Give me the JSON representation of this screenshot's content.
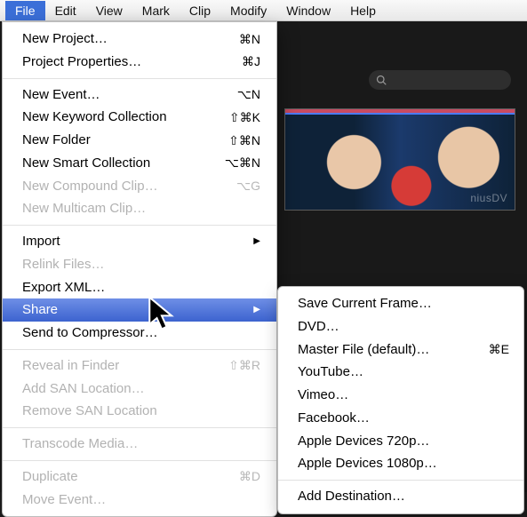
{
  "menubar": {
    "items": [
      "File",
      "Edit",
      "View",
      "Mark",
      "Clip",
      "Modify",
      "Window",
      "Help"
    ],
    "active": "File"
  },
  "file_menu": {
    "group1": [
      {
        "label": "New Project…",
        "shortcut": "⌘N",
        "enabled": true
      },
      {
        "label": "Project Properties…",
        "shortcut": "⌘J",
        "enabled": true
      }
    ],
    "group2": [
      {
        "label": "New Event…",
        "shortcut": "⌥N",
        "enabled": true
      },
      {
        "label": "New Keyword Collection",
        "shortcut": "⇧⌘K",
        "enabled": true
      },
      {
        "label": "New Folder",
        "shortcut": "⇧⌘N",
        "enabled": true
      },
      {
        "label": "New Smart Collection",
        "shortcut": "⌥⌘N",
        "enabled": true
      },
      {
        "label": "New Compound Clip…",
        "shortcut": "⌥G",
        "enabled": false
      },
      {
        "label": "New Multicam Clip…",
        "shortcut": "",
        "enabled": false
      }
    ],
    "group3": [
      {
        "label": "Import",
        "shortcut": "",
        "enabled": true,
        "submenu": true
      },
      {
        "label": "Relink Files…",
        "shortcut": "",
        "enabled": false
      },
      {
        "label": "Export XML…",
        "shortcut": "",
        "enabled": true
      },
      {
        "label": "Share",
        "shortcut": "",
        "enabled": true,
        "submenu": true,
        "highlight": true
      },
      {
        "label": "Send to Compressor…",
        "shortcut": "",
        "enabled": true
      }
    ],
    "group4": [
      {
        "label": "Reveal in Finder",
        "shortcut": "⇧⌘R",
        "enabled": false
      },
      {
        "label": "Add SAN Location…",
        "shortcut": "",
        "enabled": false
      },
      {
        "label": "Remove SAN Location",
        "shortcut": "",
        "enabled": false
      }
    ],
    "group5": [
      {
        "label": "Transcode Media…",
        "shortcut": "",
        "enabled": false
      }
    ],
    "group6": [
      {
        "label": "Duplicate",
        "shortcut": "⌘D",
        "enabled": false
      },
      {
        "label": "Move Event…",
        "shortcut": "",
        "enabled": false
      }
    ]
  },
  "share_submenu": {
    "group1": [
      {
        "label": "Save Current Frame…",
        "shortcut": ""
      },
      {
        "label": "DVD…",
        "shortcut": ""
      },
      {
        "label": "Master File (default)…",
        "shortcut": "⌘E"
      },
      {
        "label": "YouTube…",
        "shortcut": ""
      },
      {
        "label": "Vimeo…",
        "shortcut": ""
      },
      {
        "label": "Facebook…",
        "shortcut": ""
      },
      {
        "label": "Apple Devices 720p…",
        "shortcut": ""
      },
      {
        "label": "Apple Devices 1080p…",
        "shortcut": ""
      }
    ],
    "group2": [
      {
        "label": "Add Destination…",
        "shortcut": ""
      }
    ]
  },
  "preview": {
    "watermark": "niusDV"
  }
}
